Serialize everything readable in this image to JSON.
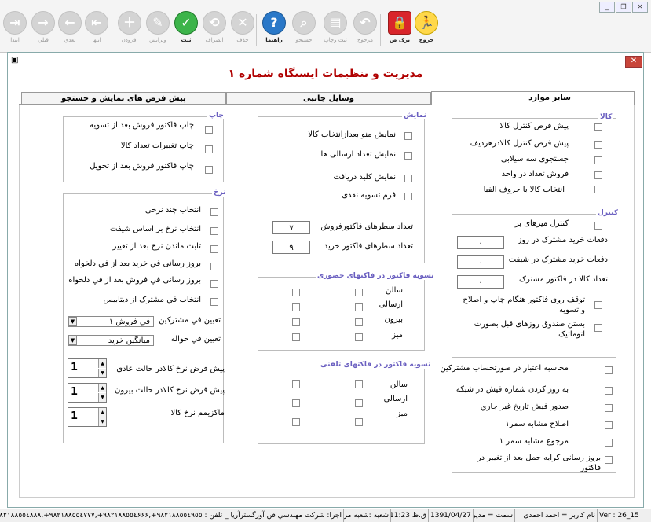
{
  "toolbar": {
    "exit": "خروج",
    "leave": "ترک ص",
    "reference": "مرجوح",
    "print": "ثبت وچاپ",
    "search": "جستجو",
    "help": "راهنما",
    "cancel": "حذف",
    "discard": "انصراف",
    "save": "ثبت",
    "edit": "ویرایش",
    "add": "افزودن",
    "last": "انتها",
    "next": "بعدي",
    "prev": "قبلي",
    "first": "ابتدا"
  },
  "window": {
    "title": "مديريت و تنظيمات ايستگاه شماره ١",
    "tabs": [
      "ساير موارد",
      "وسايل جانبی",
      "پيش فرض های نمايش و جستجو"
    ]
  },
  "kala": {
    "title": "كالا",
    "items": [
      "پيش فرض كنترل كالا",
      "پيش فرض كنترل كالادرهرديف",
      "جستجوی سه سيلابی",
      "فروش  تعداد در واحد",
      "انتخاب كالا با حروف الفبا"
    ]
  },
  "control": {
    "title": "كنترل",
    "tables": "كنترل ميزهای بر",
    "fields": [
      {
        "label": "دفعات خريد مشترک در روز",
        "value": "٠"
      },
      {
        "label": "دفعات خريد مشترک در شيفت",
        "value": "٠"
      },
      {
        "label": "تعداد كالا در فاكتور مشترک",
        "value": "٠"
      }
    ],
    "stop_print": "توقف روی فاكتور هنگام چاپ و اصلاح و تسويه",
    "close_fund": "بستن صندوق  روزهای قبل بصورت اتوماتيک"
  },
  "misc": {
    "items": [
      "محاسبه اعتبار در صورتحساب مشتركين",
      "به روز كردن شماره فيش در شبكه",
      "صدور فيش تاريخ غير جاري",
      "اصلاح مشابه سمر١",
      "مرجوع مشابه سمر ١",
      "بروز رسانی كرايه حمل بعد از تغيير در فاكتور"
    ]
  },
  "display": {
    "title": "نمايش",
    "items": [
      "نمايش منو بعدازانتخاب كالا",
      "نمايش تعداد ارسالی ها",
      "نمايش كليد دريافت",
      "فرم تسويه نقدی"
    ],
    "rows_sale_label": "تعداد سطرهای فاكتورفروش",
    "rows_sale": "٧",
    "rows_buy_label": "تعداد سطرهای فاكتور خريد",
    "rows_buy": "٩"
  },
  "settle_present": {
    "title": "تسويه فاكتور در فاكتهای حضوری",
    "labels": [
      "سالن",
      "ارسالی",
      "بيرون",
      "ميز"
    ]
  },
  "settle_phone": {
    "title": "تسويه فاكتور در فاكتهای تلفنی",
    "labels": [
      "سالن",
      "ارسالی",
      "ميز"
    ]
  },
  "print": {
    "title": "چاپ",
    "items": [
      "چاپ فاكتور فروش بعد از تسويه",
      "چاپ تغييرات  تعداد كالا",
      "چاپ فاكتور فروش بعد از تحويل"
    ]
  },
  "rate": {
    "title": "نرخ",
    "items": [
      "انتخاب چند نرخی",
      "انتخاب نرخ بر اساس شيفت",
      "ثابت ماندن نرخ بعد از تغيير",
      "بروز رسانی في خريد بعد از في دلخواه",
      "بروز رسانی في فروش بعد از في دلخواه",
      "انتخاب في مشترک از ديتابيس"
    ],
    "subscriber_label": "تعيين في مشتركين",
    "subscriber_value": "في فروش ١",
    "transfer_label": "تعيين في حواله",
    "transfer_value": "ميانگين خريد",
    "normal_label": "پيش فرض  نرخ كالادر حالت عادی",
    "normal_value": "1",
    "outside_label": "پيش فرض  نرخ كالادر حالت بيرون",
    "outside_value": "1",
    "max_label": "ماكزيمم نرخ كالا",
    "max_value": "1"
  },
  "status": {
    "ver": "Ver : 26_15",
    "user": "نام كاربر  = احمد احمدی",
    "post": "سمت = مدير",
    "date": "1391/04/27",
    "time": "ق.ظ 11:23",
    "branch": "شعبه :شعبه مركزی",
    "company": "اجرا: شركت مهندسي فن آورگسترآريا _ تلفن : ٩٨٢١٨٨٥٥٤٩٥٥+,٩٨٢١٨٨٥٥٤۶۶۶+,٩٨٢١٨٨٥٥٤٧٧٧+,٩٨٢١٨٨٥٥٤٨٨٨+"
  }
}
